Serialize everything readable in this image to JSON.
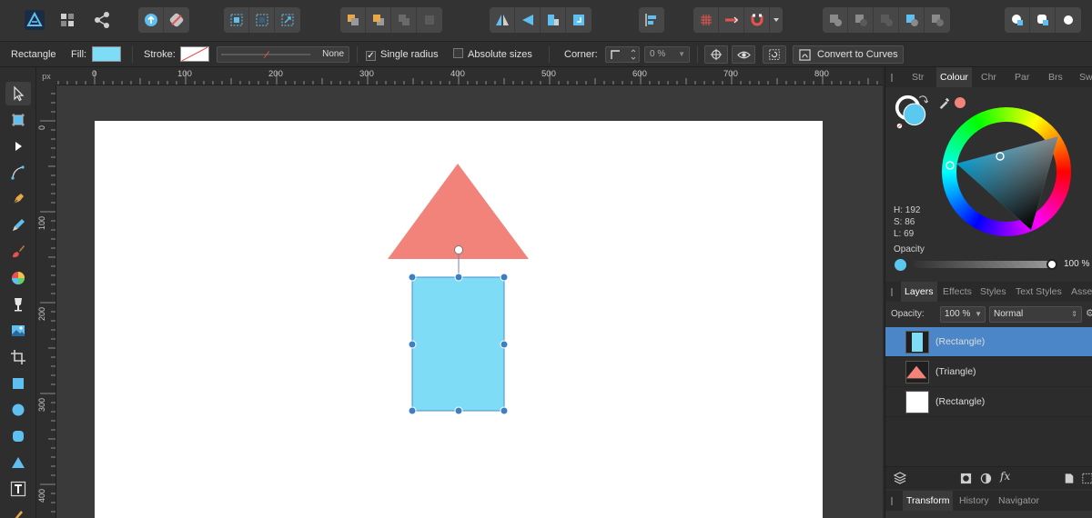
{
  "toolbar": {
    "accent": "#5fbff0"
  },
  "context": {
    "object": "Rectangle",
    "fill_label": "Fill:",
    "fill_color": "#7fdcf7",
    "stroke_label": "Stroke:",
    "stroke_value": "None",
    "single_radius": "Single radius",
    "absolute_sizes": "Absolute sizes",
    "corner_label": "Corner:",
    "corner_value": "0 %",
    "convert_label": "Convert to Curves"
  },
  "ruler": {
    "unit": "px",
    "top_labels": [
      "0",
      "100",
      "200",
      "300",
      "400",
      "500",
      "600",
      "700",
      "800"
    ],
    "left_labels": [
      "0",
      "100",
      "200",
      "300",
      "400"
    ]
  },
  "shapes": {
    "triangle_color": "#f2837a",
    "rect_color": "#7fdcf7",
    "rect_stroke": "#4a90c8",
    "handle_color": "#3d7fc0"
  },
  "colour_panel": {
    "tabs": [
      "Str",
      "Colour",
      "Chr",
      "Par",
      "Brs",
      "Sw"
    ],
    "active_tab": "Colour",
    "h": "H: 192",
    "s": "S: 86",
    "l": "L: 69",
    "opacity_label": "Opacity",
    "opacity_value": "100 %",
    "current_color": "#5bc8ef",
    "secondary_color": "#f2837a"
  },
  "layers_panel": {
    "tabs": [
      "Layers",
      "Effects",
      "Styles",
      "Text Styles",
      "Asse"
    ],
    "active_tab": "Layers",
    "opacity_label": "Opacity:",
    "opacity_value": "100 %",
    "blend_mode": "Normal",
    "layers": [
      {
        "name": "(Rectangle)",
        "selected": true
      },
      {
        "name": "(Triangle)",
        "selected": false
      },
      {
        "name": "(Rectangle)",
        "selected": false
      }
    ]
  },
  "bottom_tabs": [
    "Transform",
    "History",
    "Navigator"
  ],
  "bottom_active": "Transform"
}
